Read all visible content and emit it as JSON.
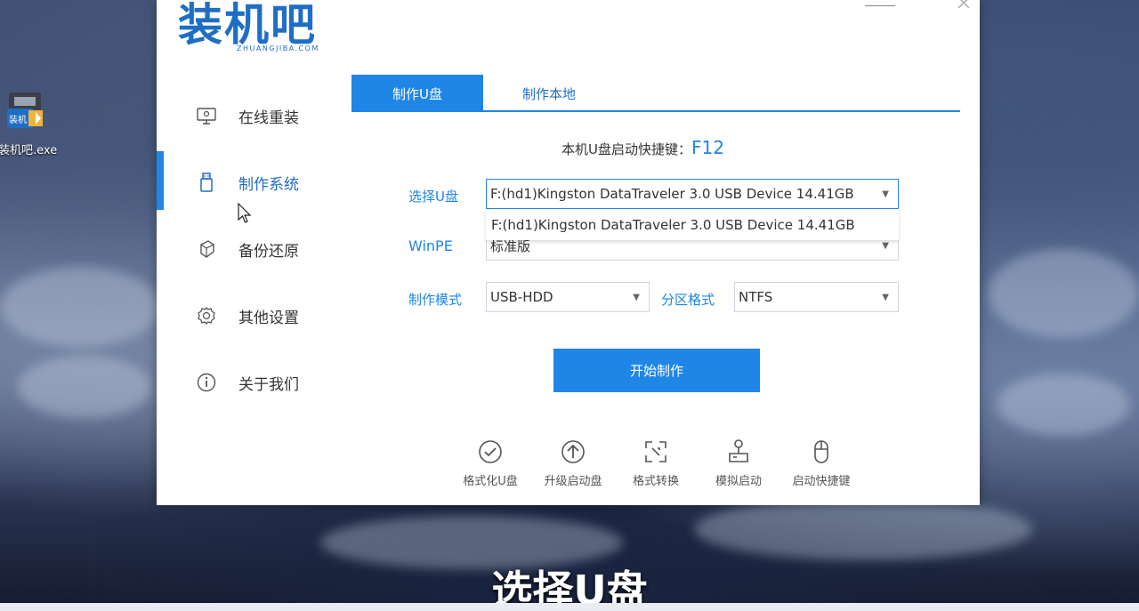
{
  "desktop": {
    "icon_label": "装机吧.exe"
  },
  "app": {
    "logo_main": "装机吧",
    "logo_sub": "ZHUANGJIBA.COM",
    "sidebar": [
      {
        "label": "在线重装",
        "icon": "monitor-icon"
      },
      {
        "label": "制作系统",
        "icon": "usb-icon",
        "active": true
      },
      {
        "label": "备份还原",
        "icon": "backup-icon"
      },
      {
        "label": "其他设置",
        "icon": "gear-icon"
      },
      {
        "label": "关于我们",
        "icon": "info-icon"
      }
    ],
    "tabs": [
      {
        "label": "制作U盘",
        "active": true
      },
      {
        "label": "制作本地"
      }
    ],
    "hotkey_label": "本机U盘启动快捷键：",
    "hotkey_value": "F12",
    "form": {
      "usb_label": "选择U盘",
      "usb_value": "F:(hd1)Kingston DataTraveler 3.0 USB Device 14.41GB",
      "usb_option": "F:(hd1)Kingston DataTraveler 3.0 USB Device 14.41GB",
      "winpe_label": "WinPE",
      "winpe_value": "标准版",
      "mode_label": "制作模式",
      "mode_value": "USB-HDD",
      "partition_label": "分区格式",
      "partition_value": "NTFS"
    },
    "start_button": "开始制作",
    "tools": [
      {
        "label": "格式化U盘",
        "icon": "check-circle-icon"
      },
      {
        "label": "升级启动盘",
        "icon": "upload-circle-icon"
      },
      {
        "label": "格式转换",
        "icon": "convert-icon"
      },
      {
        "label": "模拟启动",
        "icon": "simulate-icon"
      },
      {
        "label": "启动快捷键",
        "icon": "mouse-icon"
      }
    ]
  },
  "subtitle": "选择U盘",
  "colors": {
    "accent": "#1f86e5",
    "logo": "#1f6ec5"
  }
}
